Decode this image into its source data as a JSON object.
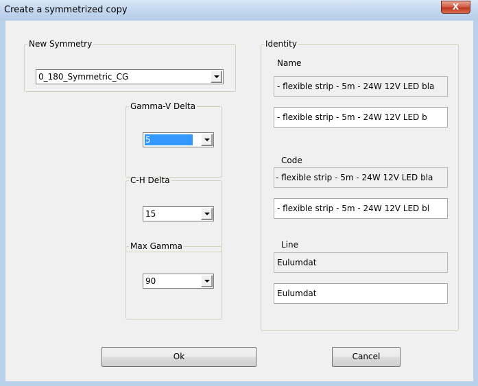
{
  "window": {
    "title": "Create a symmetrized copy",
    "close_glyph": "X"
  },
  "new_symmetry": {
    "legend": "New Symmetry",
    "selected": "0_180_Symmetric_CG"
  },
  "gamma_v_delta": {
    "legend": "Gamma-V Delta",
    "selected": "5"
  },
  "c_h_delta": {
    "legend": "C-H Delta",
    "selected": "15"
  },
  "max_gamma": {
    "legend": "Max Gamma",
    "selected": "90"
  },
  "identity": {
    "legend": "Identity",
    "name_label": "Name",
    "name_original": "- flexible strip - 5m - 24W 12V LED bla",
    "name_new": " - flexible strip - 5m - 24W  12V LED b",
    "code_label": "Code",
    "code_original": "- flexible strip - 5m - 24W 12V LED bla",
    "code_new": " - flexible strip - 5m - 24W 12V LED bl",
    "line_label": "Line",
    "line_original": "Eulumdat",
    "line_new": "Eulumdat"
  },
  "buttons": {
    "ok": "Ok",
    "cancel": "Cancel"
  },
  "colors": {
    "frame": "#b9d1ea",
    "client_bg": "#f0f0f0",
    "selection": "#3399ff",
    "close_button": "#c0391f"
  }
}
